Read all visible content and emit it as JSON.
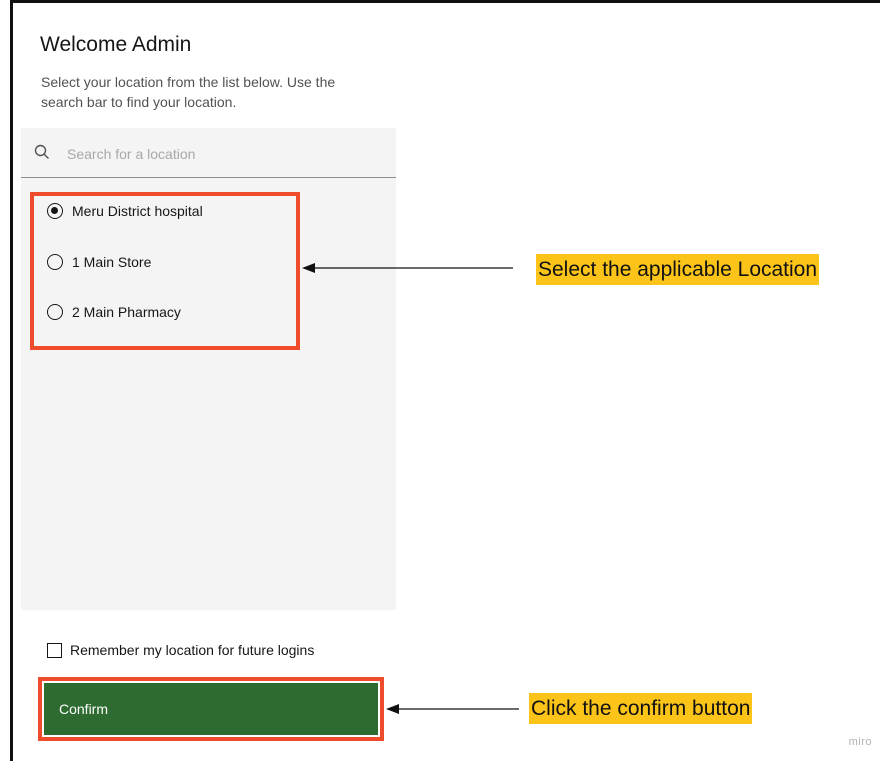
{
  "header": {
    "title": "Welcome Admin",
    "subtitle": "Select your location from the list below. Use the search bar to find your location."
  },
  "search": {
    "placeholder": "Search for a location",
    "value": "",
    "icon": "search-icon"
  },
  "locations": [
    {
      "label": "Meru District hospital",
      "selected": true
    },
    {
      "label": "1 Main Store",
      "selected": false
    },
    {
      "label": "2 Main Pharmacy",
      "selected": false
    }
  ],
  "remember": {
    "label": "Remember my location for future logins",
    "checked": false
  },
  "confirm": {
    "label": "Confirm",
    "color": "#2e6b30"
  },
  "annotations": {
    "select_note": "Select the applicable  Location",
    "confirm_note": "Click the confirm button",
    "highlight_color": "#ef4b2d",
    "note_color": "#fcc419"
  },
  "watermark": "miro"
}
